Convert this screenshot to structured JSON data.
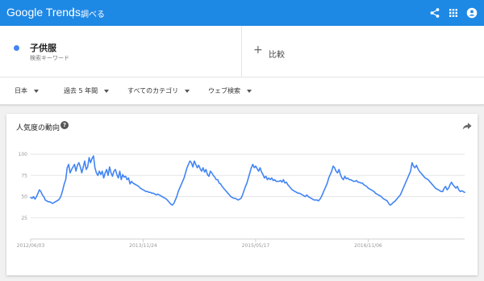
{
  "appbar": {
    "logo": "Google Trends",
    "nav_title": "調べる",
    "icons": [
      "share-icon",
      "apps-icon",
      "account-icon"
    ]
  },
  "terms": {
    "term": "子供服",
    "term_type": "検索キーワード",
    "term_color": "#4285f4",
    "compare_label": "比較"
  },
  "filters": [
    {
      "label": "日本"
    },
    {
      "label": "過去 5 年間"
    },
    {
      "label": "すべてのカテゴリ"
    },
    {
      "label": "ウェブ検索"
    }
  ],
  "card": {
    "title": "人気度の動向",
    "help_glyph": "?"
  },
  "colors": {
    "appbar": "#1e88e5",
    "series": "#4285f4",
    "grid": "#e5e5e5",
    "tick_text": "#999999"
  },
  "chart_data": {
    "type": "line",
    "ylim": [
      0,
      100
    ],
    "yticks": [
      25,
      50,
      75,
      100
    ],
    "xticks": [
      "2012/06/03",
      "2013/11/24",
      "2015/05/17",
      "2016/11/06"
    ],
    "xtick_index": [
      0,
      77,
      154,
      231
    ],
    "grid": true,
    "series": [
      {
        "values": [
          49,
          48,
          50,
          47,
          50,
          54,
          58,
          56,
          52,
          50,
          46,
          45,
          44,
          44,
          43,
          42,
          43,
          44,
          45,
          46,
          48,
          52,
          58,
          65,
          70,
          84,
          88,
          78,
          82,
          85,
          88,
          80,
          87,
          90,
          85,
          78,
          85,
          92,
          82,
          85,
          96,
          90,
          95,
          98,
          84,
          78,
          75,
          80,
          76,
          80,
          72,
          78,
          82,
          75,
          85,
          78,
          74,
          80,
          82,
          76,
          72,
          80,
          70,
          76,
          73,
          74,
          70,
          72,
          65,
          68,
          66,
          65,
          64,
          63,
          62,
          60,
          59,
          58,
          57,
          56,
          56,
          55,
          55,
          54,
          54,
          53,
          52,
          53,
          52,
          51,
          50,
          49,
          48,
          47,
          45,
          43,
          41,
          40,
          42,
          46,
          50,
          56,
          60,
          64,
          68,
          72,
          78,
          84,
          88,
          92,
          90,
          85,
          92,
          88,
          84,
          87,
          83,
          80,
          84,
          79,
          82,
          76,
          74,
          80,
          78,
          75,
          73,
          70,
          70,
          66,
          65,
          62,
          60,
          58,
          56,
          54,
          52,
          50,
          49,
          48,
          48,
          47,
          46,
          47,
          48,
          52,
          57,
          62,
          66,
          72,
          78,
          84,
          88,
          84,
          86,
          83,
          80,
          84,
          79,
          76,
          72,
          74,
          70,
          72,
          70,
          72,
          69,
          70,
          68,
          68,
          68,
          69,
          67,
          70,
          66,
          67,
          64,
          62,
          60,
          58,
          57,
          56,
          55,
          54,
          54,
          53,
          52,
          51,
          50,
          52,
          50,
          49,
          48,
          47,
          46,
          46,
          46,
          45,
          47,
          50,
          54,
          58,
          62,
          66,
          72,
          76,
          80,
          86,
          84,
          80,
          78,
          82,
          76,
          72,
          70,
          74,
          71,
          72,
          70,
          70,
          69,
          68,
          68,
          69,
          67,
          67,
          66,
          66,
          64,
          63,
          62,
          60,
          59,
          58,
          57,
          56,
          54,
          53,
          52,
          51,
          50,
          48,
          47,
          46,
          45,
          42,
          40,
          41,
          43,
          44,
          46,
          48,
          50,
          52,
          56,
          60,
          64,
          68,
          72,
          76,
          80,
          90,
          86,
          84,
          87,
          83,
          80,
          78,
          76,
          74,
          72,
          71,
          70,
          68,
          66,
          64,
          62,
          60,
          59,
          58,
          57,
          56,
          56,
          60,
          62,
          58,
          60,
          64,
          67,
          64,
          62,
          60,
          62,
          58,
          56,
          57,
          56,
          55
        ]
      }
    ]
  }
}
